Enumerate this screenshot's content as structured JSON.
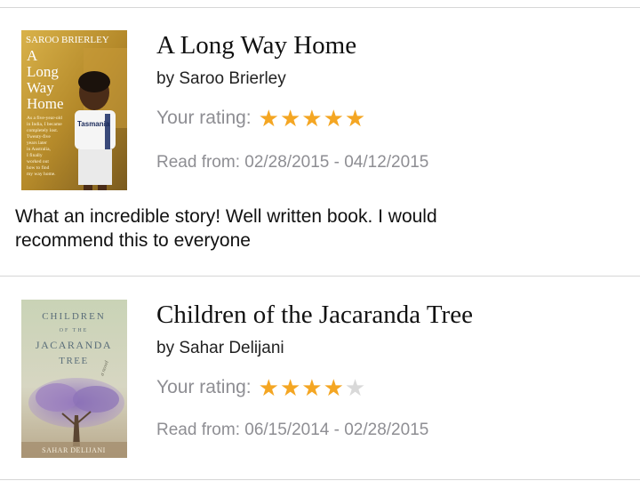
{
  "books": [
    {
      "cover": {
        "author_caps": "SAROO BRIERLEY",
        "title_lines": [
          "A",
          "Long",
          "Way",
          "Home"
        ],
        "blurb_lines": [
          "As a five-year-old",
          "in India, I became",
          "completely lost.",
          "Twenty-five",
          "years later",
          "in Australia,",
          "I finally",
          "worked out",
          "how to find",
          "my way home."
        ],
        "shirt_text": "Tasmania"
      },
      "title": "A Long Way Home",
      "author": "by Saroo Brierley",
      "rating_label": "Your rating:",
      "rating": 5,
      "rating_max": 5,
      "dates": "Read from: 02/28/2015 - 04/12/2015",
      "review_line1": "What an incredible story! Well written book. I would",
      "review_line2": "recommend this to everyone"
    },
    {
      "cover": {
        "title_line1": "CHILDREN",
        "title_line2": "OF THE",
        "title_line3": "JACARANDA",
        "title_line4": "TREE",
        "tag": "a novel",
        "author_caps": "SAHAR DELIJANI"
      },
      "title": "Children of the Jacaranda Tree",
      "author": "by Sahar Delijani",
      "rating_label": "Your rating:",
      "rating": 4,
      "rating_max": 5,
      "dates": "Read from: 06/15/2014 - 02/28/2015"
    }
  ],
  "colors": {
    "star_on": "#f4a623",
    "star_off": "#d9d9d9",
    "secondary_text": "#8e8e93",
    "divider": "#d6d6d6"
  }
}
